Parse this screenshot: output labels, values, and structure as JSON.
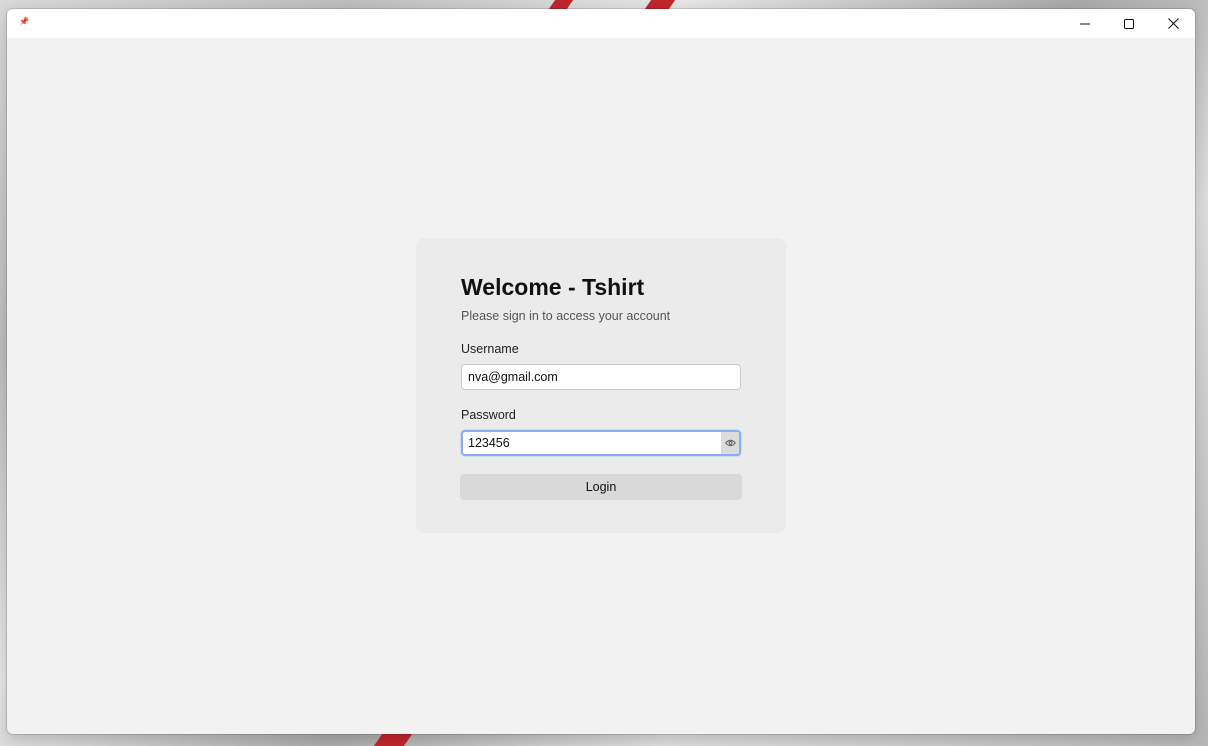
{
  "window": {
    "controls": {
      "minimize_icon": "minimize-icon",
      "maximize_icon": "maximize-icon",
      "close_icon": "close-icon"
    }
  },
  "login": {
    "title": "Welcome - Tshirt",
    "subtitle": "Please sign in to access your account",
    "username_label": "Username",
    "username_value": "nva@gmail.com",
    "password_label": "Password",
    "password_value": "123456",
    "toggle_visibility_icon": "eye-icon",
    "login_label": "Login"
  },
  "colors": {
    "window_bg": "#f2f2f2",
    "card_bg": "#ebebeb",
    "focus_border": "#86aef0",
    "button_bg": "#d9d9d9"
  }
}
